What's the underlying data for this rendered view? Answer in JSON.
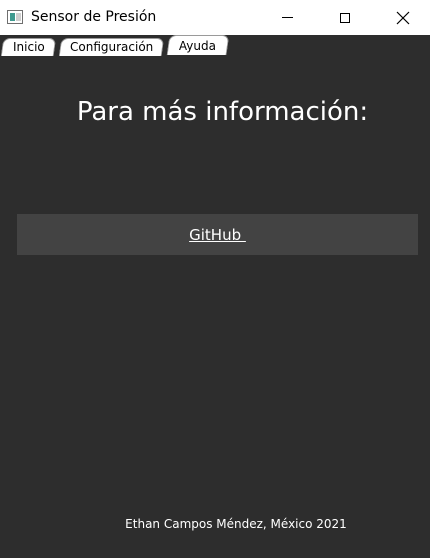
{
  "window": {
    "title": "Sensor de Presión",
    "icon": "app-window-icon"
  },
  "tabs": [
    {
      "label": "Inicio",
      "active": false
    },
    {
      "label": "Configuración",
      "active": false
    },
    {
      "label": "Ayuda",
      "active": true
    }
  ],
  "main": {
    "heading": "Para más información:",
    "link_label": "GitHub ",
    "footer": "Ethan Campos Méndez, México 2021"
  },
  "colors": {
    "background": "#2d2d2d",
    "panel": "#434343",
    "text": "#ffffff"
  }
}
